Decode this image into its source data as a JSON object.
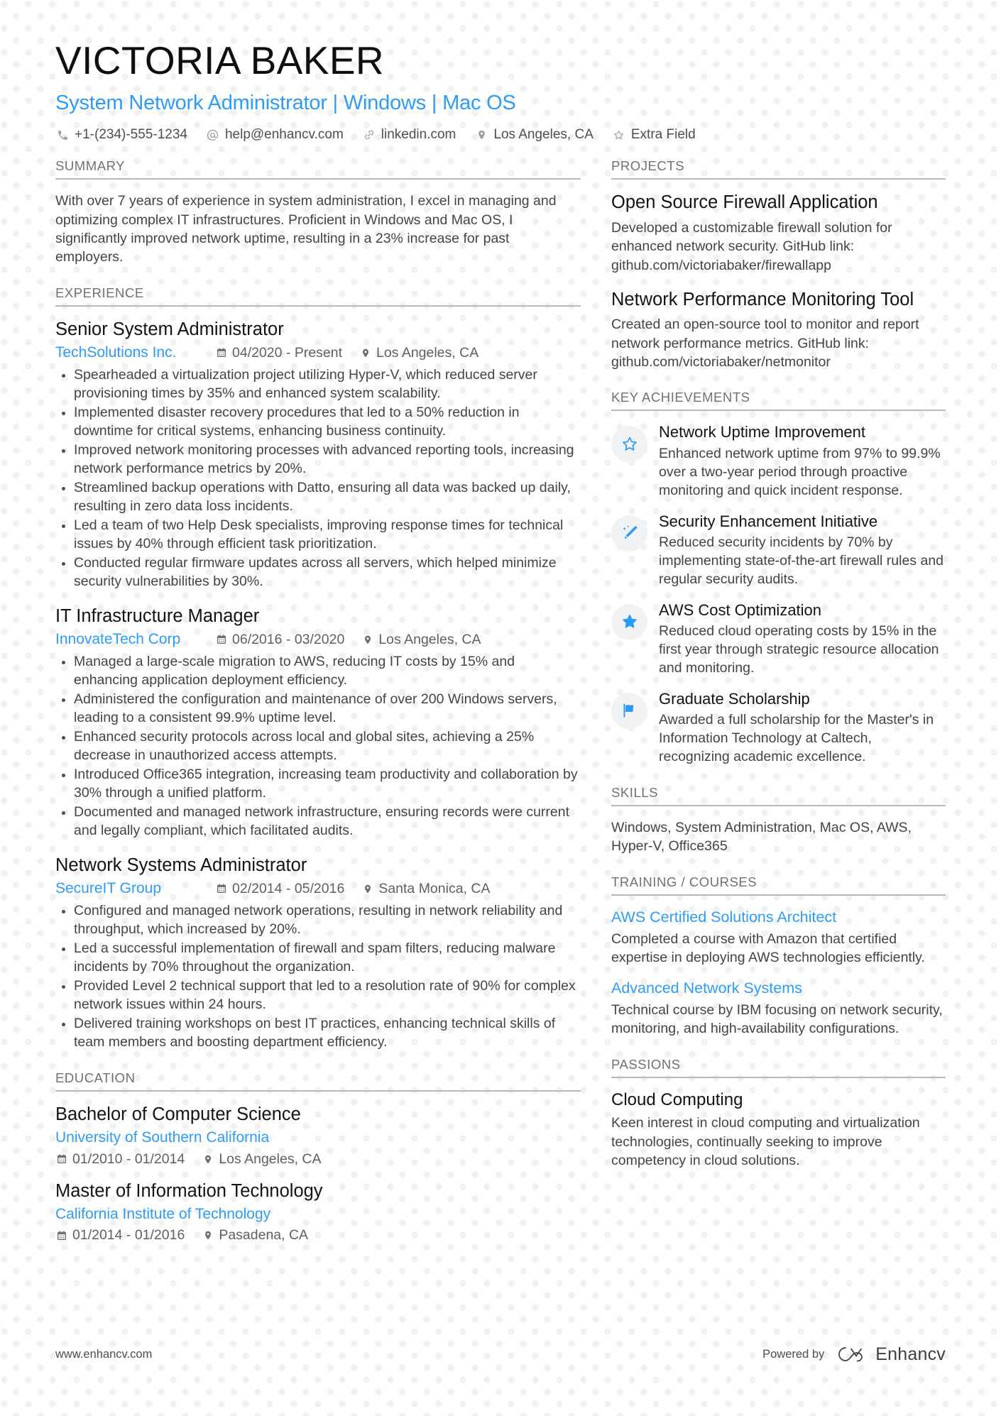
{
  "header": {
    "name": "VICTORIA BAKER",
    "headline": "System Network Administrator | Windows | Mac OS",
    "contacts": [
      {
        "icon": "phone-icon",
        "text": "+1-(234)-555-1234"
      },
      {
        "icon": "at-icon",
        "text": "help@enhancv.com"
      },
      {
        "icon": "link-icon",
        "text": "linkedin.com"
      },
      {
        "icon": "location-pin-icon",
        "text": "Los Angeles, CA"
      },
      {
        "icon": "star-outline-icon",
        "text": "Extra Field"
      }
    ]
  },
  "accent_color": "#2d9cf7",
  "left": {
    "summary": {
      "heading": "SUMMARY",
      "text": "With over 7 years of experience in system administration, I excel in managing and optimizing complex IT infrastructures. Proficient in Windows and Mac OS, I significantly improved network uptime, resulting in a 23% increase for past employers."
    },
    "experience": {
      "heading": "EXPERIENCE",
      "entries": [
        {
          "title": "Senior System Administrator",
          "company": "TechSolutions Inc.",
          "dates": "04/2020 - Present",
          "location": "Los Angeles, CA",
          "bullets": [
            "Spearheaded a virtualization project utilizing Hyper-V, which reduced server provisioning times by 35% and enhanced system scalability.",
            "Implemented disaster recovery procedures that led to a 50% reduction in downtime for critical systems, enhancing business continuity.",
            "Improved network monitoring processes with advanced reporting tools, increasing network performance metrics by 20%.",
            "Streamlined backup operations with Datto, ensuring all data was backed up daily, resulting in zero data loss incidents.",
            "Led a team of two Help Desk specialists, improving response times for technical issues by 40% through efficient task prioritization.",
            "Conducted regular firmware updates across all servers, which helped minimize security vulnerabilities by 30%."
          ]
        },
        {
          "title": "IT Infrastructure Manager",
          "company": "InnovateTech Corp",
          "dates": "06/2016 - 03/2020",
          "location": "Los Angeles, CA",
          "bullets": [
            "Managed a large-scale migration to AWS, reducing IT costs by 15% and enhancing application deployment efficiency.",
            "Administered the configuration and maintenance of over 200 Windows servers, leading to a consistent 99.9% uptime level.",
            "Enhanced security protocols across local and global sites, achieving a 25% decrease in unauthorized access attempts.",
            "Introduced Office365 integration, increasing team productivity and collaboration by 30% through a unified platform.",
            "Documented and managed network infrastructure, ensuring records were current and legally compliant, which facilitated audits."
          ]
        },
        {
          "title": "Network Systems Administrator",
          "company": "SecureIT Group",
          "dates": "02/2014 - 05/2016",
          "location": "Santa Monica, CA",
          "bullets": [
            "Configured and managed network operations, resulting in network reliability and throughput, which increased by 20%.",
            "Led a successful implementation of firewall and spam filters, reducing malware incidents by 70% throughout the organization.",
            "Provided Level 2 technical support that led to a resolution rate of 90% for complex network issues within 24 hours.",
            "Delivered training workshops on best IT practices, enhancing technical skills of team members and boosting department efficiency."
          ]
        }
      ]
    },
    "education": {
      "heading": "EDUCATION",
      "entries": [
        {
          "degree": "Bachelor of Computer Science",
          "school": "University of Southern California",
          "dates": "01/2010 - 01/2014",
          "location": "Los Angeles, CA"
        },
        {
          "degree": "Master of Information Technology",
          "school": "California Institute of Technology",
          "dates": "01/2014 - 01/2016",
          "location": "Pasadena, CA"
        }
      ]
    }
  },
  "right": {
    "projects": {
      "heading": "PROJECTS",
      "entries": [
        {
          "title": "Open Source Firewall Application",
          "description": "Developed a customizable firewall solution for enhanced network security. GitHub link: github.com/victoriabaker/firewallapp"
        },
        {
          "title": "Network Performance Monitoring Tool",
          "description": "Created an open-source tool to monitor and report network performance metrics. GitHub link: github.com/victoriabaker/netmonitor"
        }
      ]
    },
    "achievements": {
      "heading": "KEY ACHIEVEMENTS",
      "entries": [
        {
          "icon": "star-outline-icon",
          "title": "Network Uptime Improvement",
          "description": "Enhanced network uptime from 97% to 99.9% over a two-year period through proactive monitoring and quick incident response."
        },
        {
          "icon": "magic-wand-icon",
          "title": "Security Enhancement Initiative",
          "description": "Reduced security incidents by 70% by implementing state-of-the-art firewall rules and regular security audits."
        },
        {
          "icon": "star-filled-icon",
          "title": "AWS Cost Optimization",
          "description": "Reduced cloud operating costs by 15% in the first year through strategic resource allocation and monitoring."
        },
        {
          "icon": "flag-icon",
          "title": "Graduate Scholarship",
          "description": "Awarded a full scholarship for the Master's in Information Technology at Caltech, recognizing academic excellence."
        }
      ]
    },
    "skills": {
      "heading": "SKILLS",
      "text": "Windows, System Administration, Mac OS, AWS, Hyper-V, Office365"
    },
    "training": {
      "heading": "TRAINING / COURSES",
      "entries": [
        {
          "title": "AWS Certified Solutions Architect",
          "description": "Completed a course with Amazon that certified expertise in deploying AWS technologies efficiently."
        },
        {
          "title": "Advanced Network Systems",
          "description": "Technical course by IBM focusing on network security, monitoring, and high-availability configurations."
        }
      ]
    },
    "passions": {
      "heading": "PASSIONS",
      "entries": [
        {
          "title": "Cloud Computing",
          "description": "Keen interest in cloud computing and virtualization technologies, continually seeking to improve competency in cloud solutions."
        }
      ]
    }
  },
  "footer": {
    "website": "www.enhancv.com",
    "powered_by": "Powered by",
    "brand": "Enhancv"
  }
}
